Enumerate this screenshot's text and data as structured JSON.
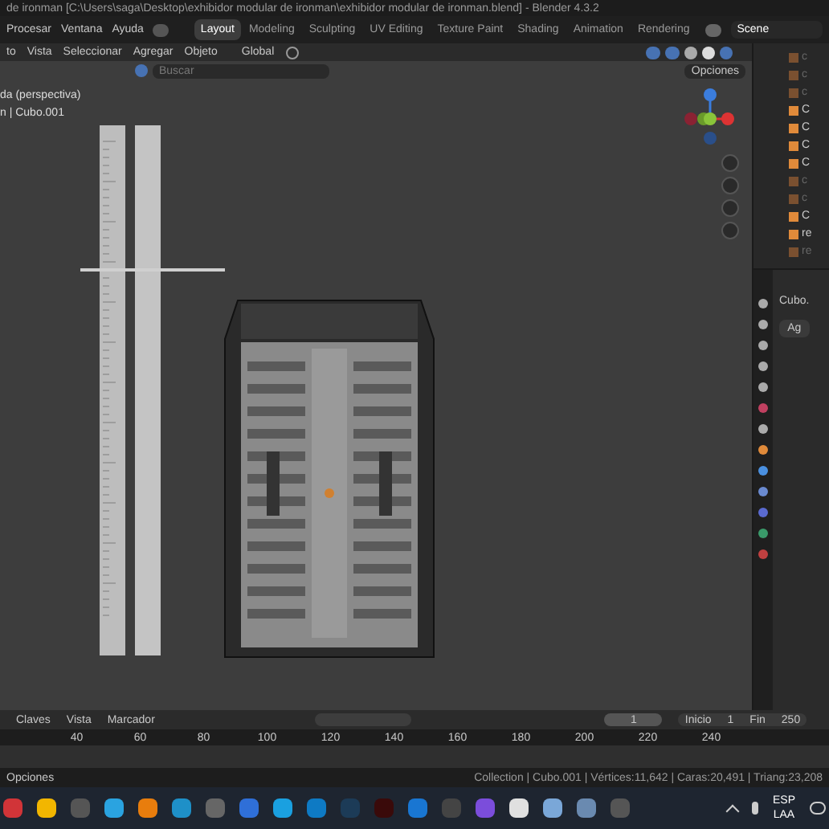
{
  "title_bar": {
    "title": "de ironman [C:\\Users\\saga\\Desktop\\exhibidor modular de ironman\\exhibidor modular de ironman.blend] - Blender 4.3.2"
  },
  "menu": [
    "Procesar",
    "Ventana",
    "Ayuda"
  ],
  "workspaces": [
    {
      "label": "Layout",
      "selected": true
    },
    {
      "label": "Modeling",
      "selected": false
    },
    {
      "label": "Sculpting",
      "selected": false
    },
    {
      "label": "UV Editing",
      "selected": false
    },
    {
      "label": "Texture Paint",
      "selected": false
    },
    {
      "label": "Shading",
      "selected": false
    },
    {
      "label": "Animation",
      "selected": false
    },
    {
      "label": "Rendering",
      "selected": false
    }
  ],
  "scene": "Scene",
  "viewport_header": {
    "mode": "to",
    "menus": [
      "Vista",
      "Seleccionar",
      "Agregar",
      "Objeto"
    ],
    "orientation": "Global"
  },
  "asset_bar": {
    "search": {
      "placeholder": "Buscar"
    },
    "options": "Opciones"
  },
  "viewport_overlay": [
    "da (perspectiva)",
    "n | Cubo.001"
  ],
  "outliner": {
    "rows": [
      {
        "label": "c",
        "dim": true
      },
      {
        "label": "c",
        "dim": true
      },
      {
        "label": "c",
        "dim": true
      },
      {
        "label": "C",
        "dim": false
      },
      {
        "label": "C",
        "dim": false
      },
      {
        "label": "C",
        "dim": false
      },
      {
        "label": "C",
        "dim": false
      },
      {
        "label": "c",
        "dim": true
      },
      {
        "label": "c",
        "dim": true
      },
      {
        "label": "C",
        "dim": false
      },
      {
        "label": "re",
        "dim": false
      },
      {
        "label": "re",
        "dim": true
      }
    ]
  },
  "properties": {
    "object": "Cubo.",
    "add_modifier": "Ag"
  },
  "timeline": {
    "menus": [
      "Claves",
      "Vista",
      "Marcador"
    ],
    "current_frame": "1",
    "start_label": "Inicio",
    "start": "1",
    "end_label": "Fin",
    "end": "250",
    "ruler": [
      "40",
      "60",
      "80",
      "100",
      "120",
      "140",
      "160",
      "180",
      "200",
      "220",
      "240"
    ]
  },
  "status_bar": {
    "left": "Opciones",
    "stats": "Collection | Cubo.001 | Vértices:11,642 | Caras:20,491 | Triang:23,208"
  },
  "taskbar": {
    "language": "ESP",
    "layout": "LAA"
  }
}
